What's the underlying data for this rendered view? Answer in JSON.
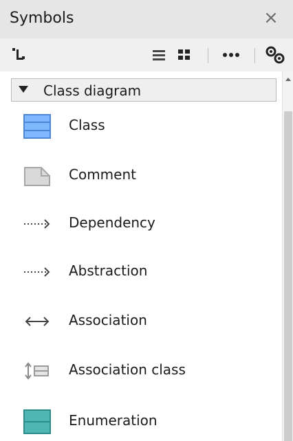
{
  "panel": {
    "title": "Symbols",
    "close_glyph": "×"
  },
  "toolbar": {
    "buttons": [
      {
        "name": "structure-icon"
      },
      {
        "name": "list-view-icon"
      },
      {
        "name": "grid-view-icon"
      },
      {
        "name": "more-icon"
      },
      {
        "name": "settings-icon"
      }
    ]
  },
  "group": {
    "label": "Class diagram",
    "expanded": true,
    "items": [
      {
        "label": "Class",
        "icon": "class-icon"
      },
      {
        "label": "Comment",
        "icon": "comment-icon"
      },
      {
        "label": "Dependency",
        "icon": "dependency-arrow-icon"
      },
      {
        "label": "Abstraction",
        "icon": "abstraction-arrow-icon"
      },
      {
        "label": "Association",
        "icon": "association-arrow-icon"
      },
      {
        "label": "Association class",
        "icon": "association-class-icon"
      },
      {
        "label": "Enumeration",
        "icon": "enumeration-icon"
      }
    ]
  },
  "colors": {
    "class_fill": "#7fb8ff",
    "enumeration_fill": "#4fb6b3",
    "comment_fill": "#d9d9d9"
  }
}
